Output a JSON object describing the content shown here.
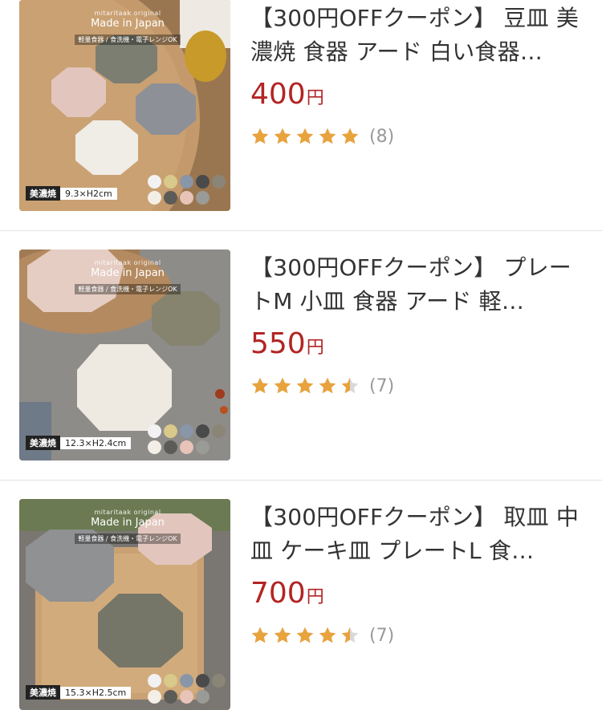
{
  "products": [
    {
      "title": "【300円OFFクーポン】 豆皿 美濃焼 食器 アード 白い食器…",
      "price": "400",
      "yen": "円",
      "rating_count": "(8)",
      "stars": [
        1,
        1,
        1,
        1,
        1
      ],
      "badge_label": "美濃焼",
      "badge_size": "9.3×H2cm",
      "brand": "mitaritaak original",
      "made_in": "Made in Japan",
      "made_sub": "軽量食器 / 食洗機・電子レンジOK",
      "bg": "#b88f62"
    },
    {
      "title": "【300円OFFクーポン】 プレートM 小皿 食器 アード 軽…",
      "price": "550",
      "yen": "円",
      "rating_count": "(7)",
      "stars": [
        1,
        1,
        1,
        1,
        0.5
      ],
      "badge_label": "美濃焼",
      "badge_size": "12.3×H2.4cm",
      "brand": "mitaritaak original",
      "made_in": "Made in Japan",
      "made_sub": "軽量食器 / 食洗機・電子レンジOK",
      "bg": "#8d8b88"
    },
    {
      "title": "【300円OFFクーポン】 取皿 中皿 ケーキ皿 プレートL 食…",
      "price": "700",
      "yen": "円",
      "rating_count": "(7)",
      "stars": [
        1,
        1,
        1,
        1,
        0.5
      ],
      "badge_label": "美濃焼",
      "badge_size": "15.3×H2.5cm",
      "brand": "mitaritaak original",
      "made_in": "Made in Japan",
      "made_sub": "軽量食器 / 食洗機・電子レンジOK",
      "bg": "#7c7872"
    }
  ],
  "colors": {
    "price": "#b32424",
    "star_filled": "#e8a33d",
    "star_empty": "#d9d9d9",
    "swatches": [
      "#f2f2f2",
      "#d9c98a",
      "#8896a8",
      "#4a4a4a",
      "#8a8576",
      "#f4efe6",
      "#5b5b58",
      "#e7c3b8",
      "#9a9a96"
    ]
  }
}
